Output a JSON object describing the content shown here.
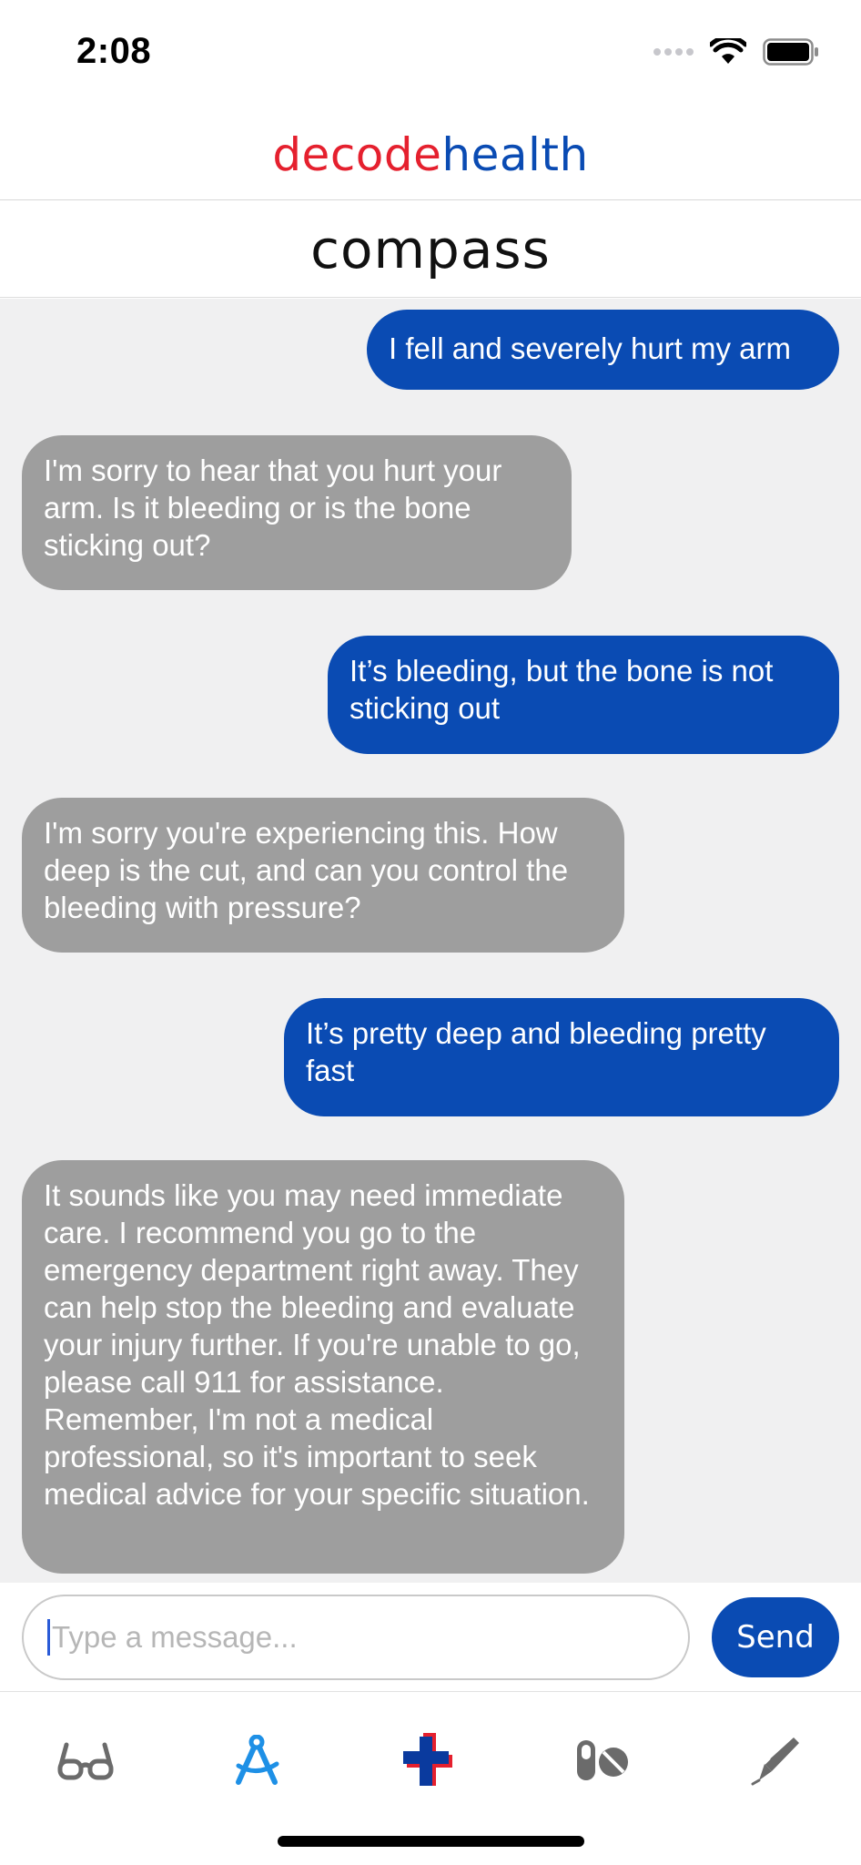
{
  "status_bar": {
    "time": "2:08"
  },
  "brand": {
    "part1": "decode",
    "part2": "health"
  },
  "page": {
    "title": "compass"
  },
  "messages": [
    {
      "role": "user",
      "text": "I fell and severely hurt my arm"
    },
    {
      "role": "bot",
      "text": "I'm sorry to hear that you hurt your arm. Is it bleeding or is the bone sticking out?"
    },
    {
      "role": "user",
      "text": "It’s bleeding, but the bone is not sticking out"
    },
    {
      "role": "bot",
      "text": "I'm sorry you're experiencing this. How deep is the cut, and can you control the bleeding with pressure?"
    },
    {
      "role": "user",
      "text": "It’s pretty deep and bleeding pretty fast"
    },
    {
      "role": "bot",
      "text": "It sounds like you may need immediate care. I recommend you go to the emergency department right away. They can help stop the bleeding and evaluate your injury further. If you're unable to go, please call 911 for assistance. Remember, I'm not a medical professional, so it's important to seek medical advice for your specific situation."
    }
  ],
  "composer": {
    "placeholder": "Type a message...",
    "send_label": "Send"
  },
  "tabs": [
    {
      "icon": "glasses-icon",
      "active": false
    },
    {
      "icon": "compass-icon",
      "active": true
    },
    {
      "icon": "medical-cross-icon",
      "active": false
    },
    {
      "icon": "pills-icon",
      "active": false
    },
    {
      "icon": "pen-icon",
      "active": false
    }
  ],
  "colors": {
    "user_bubble": "#0a4bb3",
    "bot_bubble": "#9e9e9e",
    "brand_red": "#e5202e",
    "brand_blue": "#0a4bb3",
    "tab_active": "#1e90e6",
    "tab_inactive": "#6b6b6b"
  }
}
